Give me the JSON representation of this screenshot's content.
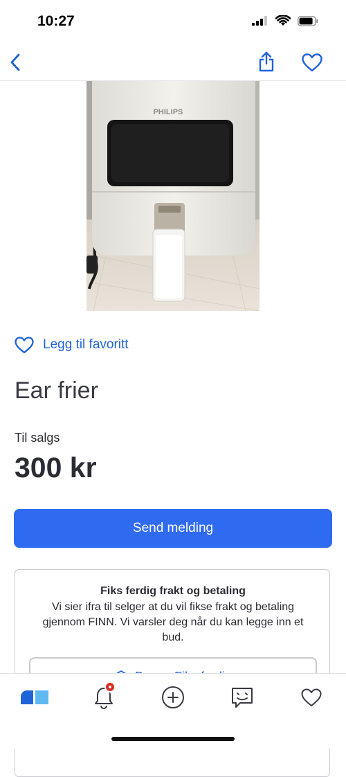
{
  "status_bar": {
    "time": "10:27",
    "icons": [
      "cellular-signal-icon",
      "wifi-icon",
      "battery-icon"
    ]
  },
  "nav": {
    "back_icon": "chevron-left-icon",
    "share_icon": "share-icon",
    "favorite_icon": "heart-outline-icon"
  },
  "listing": {
    "photo_brand_text": "PHILIPS",
    "favorite_link": "Legg til favoritt",
    "title": "Ear frier",
    "status": "Til salgs",
    "price": "300 kr",
    "send_button": "Send melding"
  },
  "shipping_card": {
    "title": "Fiks ferdig frakt og betaling",
    "text": "Vi sier ifra til selger at du vil fikse frakt og betaling gjennom FINN. Vi varsler deg når du kan legge inn et bud.",
    "button_label": "Be om Fiks ferdig"
  },
  "tab_bar": {
    "tabs": [
      "home-tab-icon",
      "notifications-bell-icon",
      "new-ad-plus-icon",
      "messages-icon",
      "favorites-heart-icon"
    ],
    "notification_badge": true
  },
  "colors": {
    "accent": "#2f6bf0",
    "link": "#1f63d9",
    "text": "#2b2b33",
    "badge": "#d92d20"
  }
}
